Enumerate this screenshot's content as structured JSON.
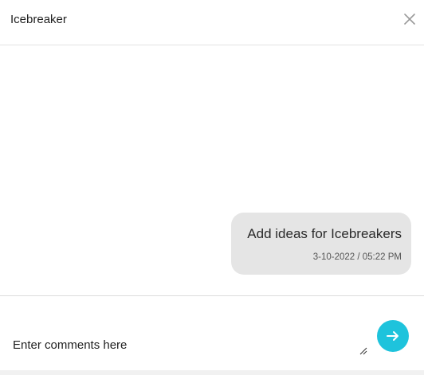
{
  "header": {
    "title": "Icebreaker",
    "close_icon": "close-icon"
  },
  "messages": [
    {
      "text": "Add ideas for Icebreakers",
      "timestamp": "3-10-2022 / 05:22 PM"
    }
  ],
  "composer": {
    "placeholder": "Enter comments here",
    "value": "",
    "send_icon": "arrow-right-icon"
  },
  "colors": {
    "accent": "#1ec3dc",
    "bubble": "#e5e5e5",
    "divider": "#e3e3e3"
  }
}
